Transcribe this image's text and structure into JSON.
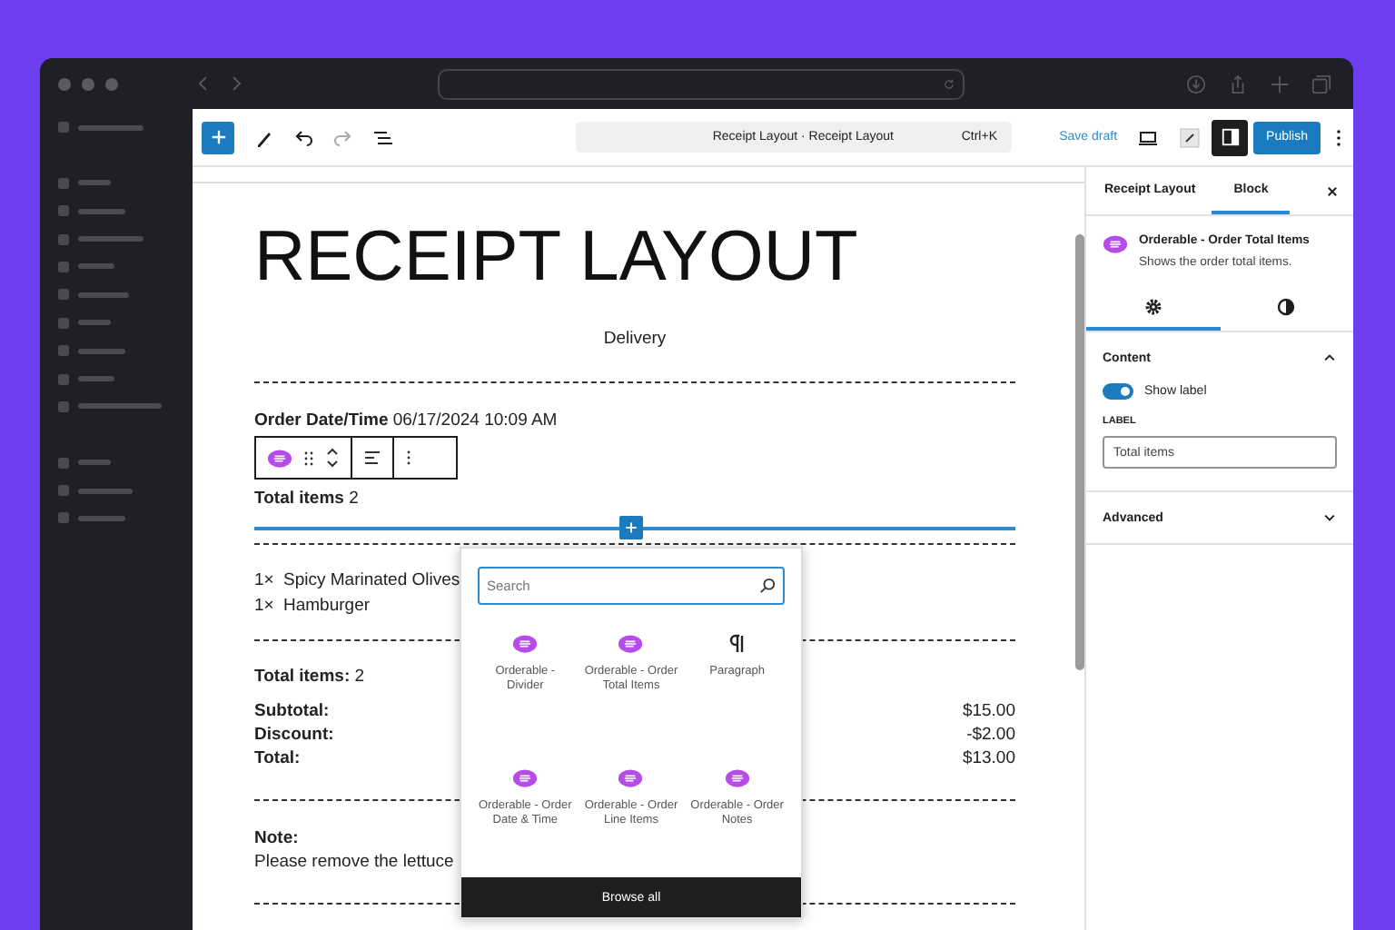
{
  "toolbar": {
    "command_bar": {
      "title": "Receipt Layout · Receipt Layout",
      "shortcut": "Ctrl+K"
    },
    "save_draft": "Save draft",
    "publish": "Publish"
  },
  "receipt": {
    "title": "RECEIPT LAYOUT",
    "order_type": "Delivery",
    "order_date": {
      "label": "Order Date/Time",
      "value": "06/17/2024 10:09 AM"
    },
    "total_items_block": {
      "label": "Total items",
      "value": "2"
    },
    "line_items": [
      {
        "qty": "1×",
        "name": "Spicy Marinated Olives"
      },
      {
        "qty": "1×",
        "name": "Hamburger"
      }
    ],
    "summary_total_items": {
      "label": "Total items:",
      "value": "2"
    },
    "totals": [
      {
        "label": "Subtotal:",
        "value": "$15.00"
      },
      {
        "label": "Discount:",
        "value": "-$2.00"
      },
      {
        "label": "Total:",
        "value": "$13.00"
      }
    ],
    "note": {
      "label": "Note:",
      "text": "Please remove the lettuce"
    }
  },
  "inserter": {
    "search": {
      "placeholder": "Search"
    },
    "blocks": [
      {
        "label": "Orderable - Divider",
        "kind": "orderable"
      },
      {
        "label": "Orderable - Order Total Items",
        "kind": "orderable"
      },
      {
        "label": "Paragraph",
        "kind": "paragraph"
      },
      {
        "label": "Orderable - Order Date & Time",
        "kind": "orderable"
      },
      {
        "label": "Orderable - Order Line Items",
        "kind": "orderable"
      },
      {
        "label": "Orderable - Order Notes",
        "kind": "orderable"
      }
    ],
    "browse_all": "Browse all"
  },
  "settings_panel": {
    "tabs": [
      {
        "label": "Receipt Layout",
        "selected": false
      },
      {
        "label": "Block",
        "selected": true
      }
    ],
    "block_card": {
      "title": "Orderable - Order Total Items",
      "description": "Shows the order total items."
    },
    "icon_tabs": [
      {
        "kind": "settings",
        "selected": true
      },
      {
        "kind": "styles",
        "selected": false
      }
    ],
    "sections": [
      {
        "title": "Content",
        "expanded": true,
        "toggle": {
          "label": "Show label",
          "on": true
        },
        "field": {
          "label": "LABEL",
          "value": "Total items"
        }
      },
      {
        "title": "Advanced",
        "expanded": false
      }
    ]
  }
}
